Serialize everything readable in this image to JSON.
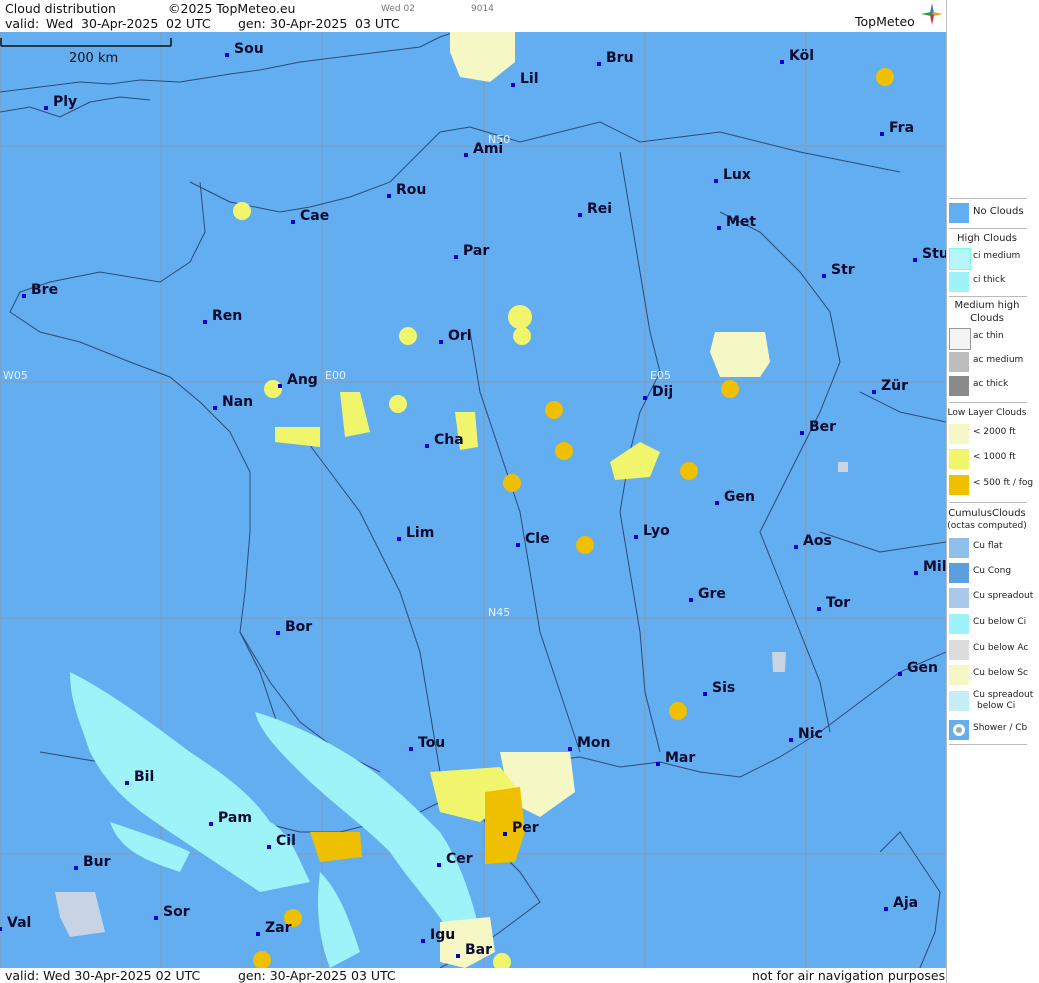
{
  "header": {
    "title": "Cloud distribution",
    "copyright": "©2025 TopMeteo.eu",
    "valid_label": "valid:",
    "valid_day": "Wed",
    "valid_date": "30-Apr-2025",
    "valid_time": "02 UTC",
    "gen_label": "gen:",
    "gen_date": "30-Apr-2025",
    "gen_time": "03 UTC",
    "small_day": "Wed 02",
    "small_code": "9014",
    "logo": "TopMeteo"
  },
  "footer": {
    "valid": "valid:  Wed  30-Apr-2025  02 UTC",
    "gen": "gen: 30-Apr-2025 03 UTC",
    "note": "not for air navigation purposes"
  },
  "scale_label": "200 km",
  "grid_labels": {
    "n50": "N50",
    "n45": "N45",
    "w05": "W05",
    "e00": "E00",
    "e05": "E05"
  },
  "cities": [
    "Sou",
    "Bru",
    "Köl",
    "Ply",
    "Lil",
    "Ami",
    "Fra",
    "Lux",
    "Rou",
    "Cae",
    "Rei",
    "Met",
    "Par",
    "Stu",
    "Str",
    "Bre",
    "Ren",
    "Orl",
    "Ang",
    "Nan",
    "Dij",
    "Zür",
    "Cha",
    "Ber",
    "Gen",
    "Lim",
    "Cle",
    "Lyo",
    "Aos",
    "Mil",
    "Gre",
    "Tor",
    "Bor",
    "Sis",
    "Gen",
    "Nic",
    "Tou",
    "Mon",
    "Mar",
    "Bil",
    "Pam",
    "Per",
    "Cil",
    "Cer",
    "Bur",
    "Sor",
    "Aja",
    "Val",
    "Zar",
    "Igu",
    "Bar"
  ],
  "legend": {
    "no_clouds": "No Clouds",
    "high_title": "High Clouds",
    "ci_medium": "ci medium",
    "ci_thick": "ci thick",
    "medium_title_1": "Medium high",
    "medium_title_2": "Clouds",
    "ac_thin": "ac thin",
    "ac_medium": "ac medium",
    "ac_thick": "ac thick",
    "low_title": "Low Layer Clouds",
    "low_2000": "< 2000 ft",
    "low_1000": "< 1000 ft",
    "low_500": "< 500 ft / fog",
    "cu_title": "CumulusClouds",
    "cu_sub": "(octas computed)",
    "cu_flat": "Cu flat",
    "cu_cong": "Cu Cong",
    "cu_spread": "Cu spreadout",
    "cu_below_ci": "Cu below Ci",
    "cu_below_ac": "Cu below Ac",
    "cu_below_sc": "Cu below Sc",
    "cu_spread_ci_1": "Cu spreadout",
    "cu_spread_ci_2": "below Ci",
    "shower": "Shower / Cb"
  },
  "colors": {
    "sea_land": "#62aef0",
    "ci": "#9df3f7",
    "low_2000": "#f5f8c4",
    "low_1000": "#f1f56c",
    "low_500": "#eec000"
  }
}
